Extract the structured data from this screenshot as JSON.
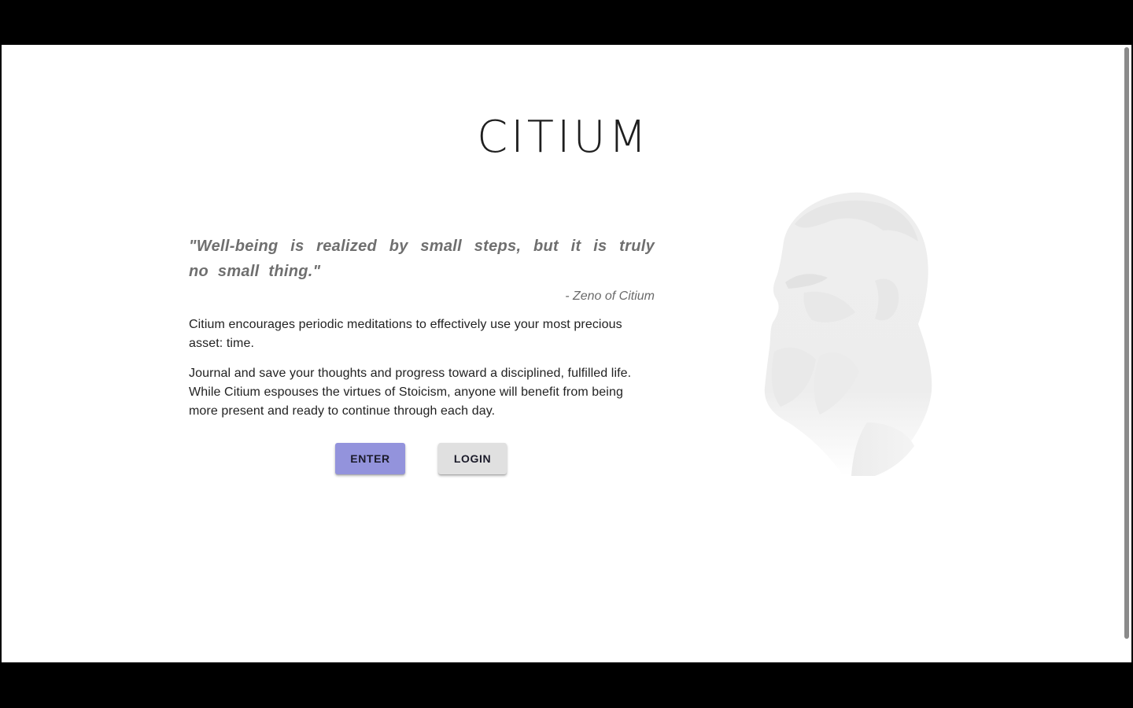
{
  "app": {
    "title": "CITIUM"
  },
  "quote": {
    "text": "\"Well-being is realized by small steps, but it is truly no small thing.\"",
    "author": "- Zeno of Citium"
  },
  "description": {
    "paragraph1": "Citium encourages periodic meditations to effectively use your most precious asset: time.",
    "paragraph2": "Journal and save your thoughts and progress toward a disciplined, fulfilled life. While Citium espouses the virtues of Stoicism, anyone will benefit from being more present and ready to continue through each day."
  },
  "actions": {
    "enter_label": "ENTER",
    "login_label": "LOGIN"
  },
  "illustration": {
    "icon": "zeno-bust-image"
  },
  "colors": {
    "accent": "#9393dc",
    "secondary_button": "#e0e0e0",
    "text": "#222222",
    "muted_text": "#6f6f6f"
  }
}
